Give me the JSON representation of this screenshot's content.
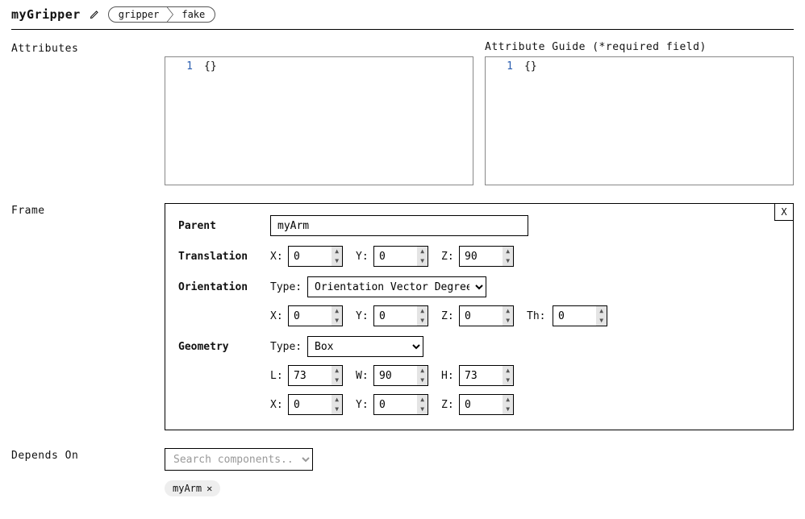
{
  "header": {
    "title": "myGripper",
    "crumb1": "gripper",
    "crumb2": "fake"
  },
  "labels": {
    "attributes": "Attributes",
    "guide": "Attribute Guide (*required field)",
    "frame": "Frame",
    "depends": "Depends On"
  },
  "attributes": {
    "line_no": "1",
    "content": "{}",
    "guide_line_no": "1",
    "guide_content": "{}"
  },
  "frame": {
    "close": "X",
    "parent_label": "Parent",
    "parent_value": "myArm",
    "translation_label": "Translation",
    "translation": {
      "x_label": "X:",
      "x": "0",
      "y_label": "Y:",
      "y": "0",
      "z_label": "Z:",
      "z": "90"
    },
    "orientation_label": "Orientation",
    "orientation": {
      "type_label": "Type:",
      "type_value": "Orientation Vector Degrees",
      "x_label": "X:",
      "x": "0",
      "y_label": "Y:",
      "y": "0",
      "z_label": "Z:",
      "z": "0",
      "th_label": "Th:",
      "th": "0"
    },
    "geometry_label": "Geometry",
    "geometry": {
      "type_label": "Type:",
      "type_value": "Box",
      "l_label": "L:",
      "l": "73",
      "w_label": "W:",
      "w": "90",
      "h_label": "H:",
      "h": "73",
      "x_label": "X:",
      "x": "0",
      "y_label": "Y:",
      "y": "0",
      "z_label": "Z:",
      "z": "0"
    }
  },
  "depends": {
    "placeholder": "Search components...",
    "chips": [
      "myArm"
    ]
  }
}
